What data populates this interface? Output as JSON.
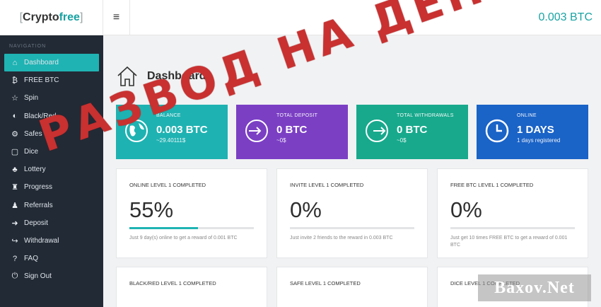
{
  "brand": {
    "open": "[",
    "word1": "Crypto",
    "word2": "free",
    "close": "]"
  },
  "topbar": {
    "menu_icon": "hamburger-icon",
    "balance": "0.003 BTC"
  },
  "sidebar": {
    "heading": "NAVIGATION",
    "items": [
      {
        "label": "Dashboard",
        "icon": "home-icon",
        "glyph": "⌂",
        "active": true
      },
      {
        "label": "FREE BTC",
        "icon": "bitcoin-icon",
        "glyph": "₿"
      },
      {
        "label": "Spin",
        "icon": "star-icon",
        "glyph": "☆"
      },
      {
        "label": "Black/Red",
        "icon": "half-circle-icon",
        "glyph": "◐"
      },
      {
        "label": "Safes",
        "icon": "safe-icon",
        "glyph": "⚙"
      },
      {
        "label": "Dice",
        "icon": "square-icon",
        "glyph": "▢"
      },
      {
        "label": "Lottery",
        "icon": "clover-icon",
        "glyph": "♣"
      },
      {
        "label": "Progress",
        "icon": "trophy-icon",
        "glyph": "♜"
      },
      {
        "label": "Referrals",
        "icon": "users-icon",
        "glyph": "♟"
      },
      {
        "label": "Deposit",
        "icon": "sign-in-icon",
        "glyph": "➜"
      },
      {
        "label": "Withdrawal",
        "icon": "sign-out-icon",
        "glyph": "↪"
      },
      {
        "label": "FAQ",
        "icon": "question-icon",
        "glyph": "?"
      },
      {
        "label": "Sign Out",
        "icon": "power-icon",
        "glyph": "⏻"
      }
    ]
  },
  "page": {
    "title": "Dashboard",
    "icon": "home-outline-icon"
  },
  "stats": [
    {
      "label": "BALANCE",
      "value": "0.003 BTC",
      "sub": "~29.40111$",
      "color": "#1fb2b2",
      "icon": "globe-icon"
    },
    {
      "label": "TOTAL DEPOSIT",
      "value": "0 BTC",
      "sub": "~0$",
      "color": "#7b3fc4",
      "icon": "sign-in-circle-icon"
    },
    {
      "label": "TOTAL WITHDRAWALS",
      "value": "0 BTC",
      "sub": "~0$",
      "color": "#18a98c",
      "icon": "sign-out-circle-icon"
    },
    {
      "label": "ONLINE",
      "value": "1 DAYS",
      "sub": "1 days registered",
      "color": "#1a63c7",
      "icon": "clock-icon"
    }
  ],
  "achievements": [
    {
      "title": "ONLINE LEVEL 1 COMPLETED",
      "percent": "55%",
      "progress": 0.55,
      "desc": "Just 9 day(s) online to get a reward of 0.001 BTC"
    },
    {
      "title": "INVITE LEVEL 1 COMPLETED",
      "percent": "0%",
      "progress": 0,
      "desc": "Just invite 2 friends to the reward in 0.003 BTC"
    },
    {
      "title": "FREE BTC LEVEL 1 COMPLETED",
      "percent": "0%",
      "progress": 0,
      "desc": "Just get 10 times FREE BTC to get a reward of 0.001 BTC"
    },
    {
      "title": "BLACK/RED LEVEL 1 COMPLETED"
    },
    {
      "title": "SAFE LEVEL 1 COMPLETED"
    },
    {
      "title": "DICE LEVEL 1 COMPLETED"
    }
  ],
  "overlay": {
    "stamp": "РАЗВОД НА ДЕНЬГИ",
    "watermark": "Baxov.Net"
  }
}
